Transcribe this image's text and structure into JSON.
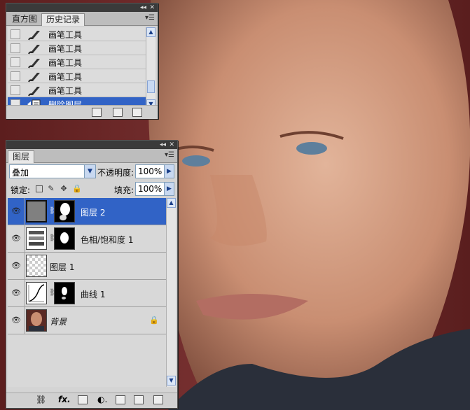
{
  "history_panel": {
    "tabs": [
      "直方图",
      "历史记录"
    ],
    "items": [
      {
        "label": "画笔工具",
        "icon": "brush-icon"
      },
      {
        "label": "画笔工具",
        "icon": "brush-icon"
      },
      {
        "label": "画笔工具",
        "icon": "brush-icon"
      },
      {
        "label": "画笔工具",
        "icon": "brush-icon"
      },
      {
        "label": "画笔工具",
        "icon": "brush-icon"
      },
      {
        "label": "删除图层",
        "icon": "delete-layer-icon",
        "selected": true
      }
    ]
  },
  "layers_panel": {
    "tab": "图层",
    "blend_mode": "叠加",
    "opacity_label": "不透明度:",
    "opacity": "100%",
    "lock_label": "锁定:",
    "fill_label": "填充:",
    "fill": "100%",
    "layers": [
      {
        "name": "图层 2",
        "selected": true,
        "has_mask": true
      },
      {
        "name": "色相/饱和度 1",
        "selected": false,
        "has_mask": true
      },
      {
        "name": "图层 1",
        "selected": false,
        "has_mask": false
      },
      {
        "name": "曲线 1",
        "selected": false,
        "has_mask": true
      },
      {
        "name": "背景",
        "selected": false,
        "has_mask": false,
        "locked": true
      }
    ]
  },
  "colors": {
    "selection": "#3163c6",
    "panel_bg": "#d4d4d4"
  }
}
